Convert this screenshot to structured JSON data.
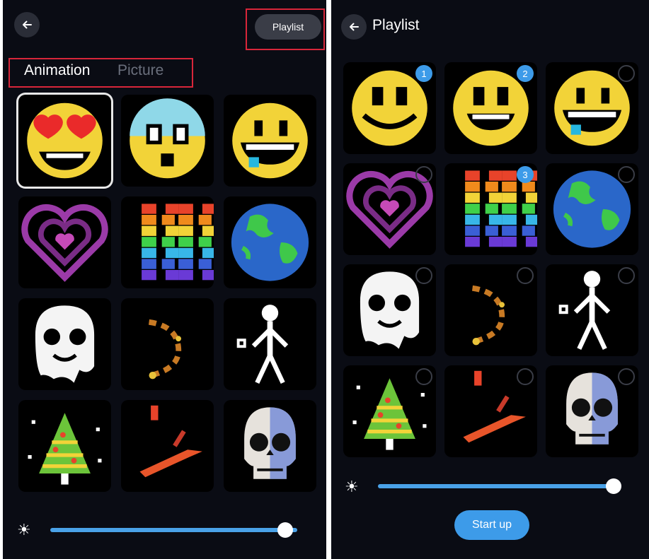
{
  "left_screen": {
    "playlist_button": "Playlist",
    "tabs": [
      {
        "label": "Animation",
        "active": true
      },
      {
        "label": "Picture",
        "active": false
      }
    ],
    "tiles": [
      {
        "icon": "heart-eyes-emoji",
        "selected": true
      },
      {
        "icon": "shocked-emoji",
        "selected": false
      },
      {
        "icon": "drooling-emoji",
        "selected": false
      },
      {
        "icon": "pulsing-heart",
        "selected": false
      },
      {
        "icon": "rainbow-helix",
        "selected": false
      },
      {
        "icon": "earth-globe",
        "selected": false
      },
      {
        "icon": "ghost",
        "selected": false
      },
      {
        "icon": "spark-trail",
        "selected": false
      },
      {
        "icon": "stick-figure",
        "selected": false
      },
      {
        "icon": "christmas-tree",
        "selected": false
      },
      {
        "icon": "shooting-streak",
        "selected": false
      },
      {
        "icon": "skull",
        "selected": false
      }
    ],
    "brightness": 0.95
  },
  "right_screen": {
    "title": "Playlist",
    "tiles": [
      {
        "icon": "smiley-emoji",
        "order": "1"
      },
      {
        "icon": "grinning-emoji",
        "order": "2"
      },
      {
        "icon": "drooling-emoji",
        "order": ""
      },
      {
        "icon": "pulsing-heart",
        "order": ""
      },
      {
        "icon": "rainbow-helix",
        "order": "3"
      },
      {
        "icon": "earth-globe",
        "order": ""
      },
      {
        "icon": "ghost",
        "order": ""
      },
      {
        "icon": "spark-trail",
        "order": ""
      },
      {
        "icon": "stick-figure",
        "order": ""
      },
      {
        "icon": "christmas-tree",
        "order": ""
      },
      {
        "icon": "shooting-streak",
        "order": ""
      },
      {
        "icon": "skull",
        "order": ""
      }
    ],
    "brightness": 0.97,
    "start_button": "Start up"
  },
  "colors": {
    "background": "#0a0c14",
    "accent_blue": "#3d9be9",
    "highlight_red": "#d8263a",
    "emoji_yellow": "#f2d338"
  }
}
